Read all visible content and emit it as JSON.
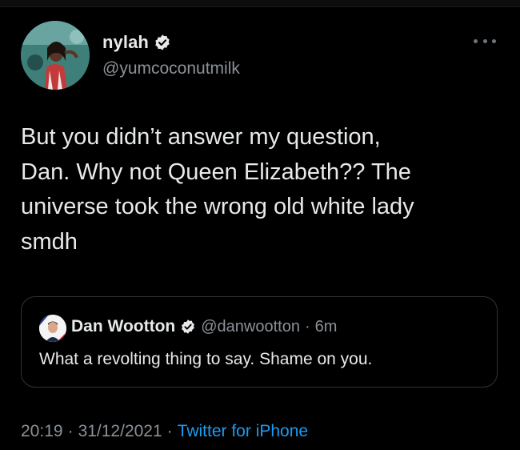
{
  "colors": {
    "background": "#000000",
    "text_primary": "#e7e9ea",
    "text_secondary": "#8b9197",
    "link": "#1d9bf0",
    "verified_badge": "#e7e9ea",
    "quote_border": "#2f3336"
  },
  "icons": {
    "verified": "verified-badge-icon",
    "more": "more-horizontal-icon",
    "author_avatar": "avatar",
    "quote_avatar": "avatar"
  },
  "tweet": {
    "author": {
      "name": "nylah",
      "handle": "@yumcoconutmilk"
    },
    "text": "But you didn’t answer my question,\nDan. Why not Queen Elizabeth?? The\nuniverse took the wrong old white lady\nsmdh",
    "quote": {
      "name": "Dan Wootton",
      "handle": "@danwootton",
      "separator": "·",
      "time": "6m",
      "text": "What a revolting thing to say. Shame on you."
    },
    "meta": {
      "time": "20:19",
      "sep1": "·",
      "date": "31/12/2021",
      "sep2": "·",
      "source": "Twitter for iPhone"
    }
  }
}
